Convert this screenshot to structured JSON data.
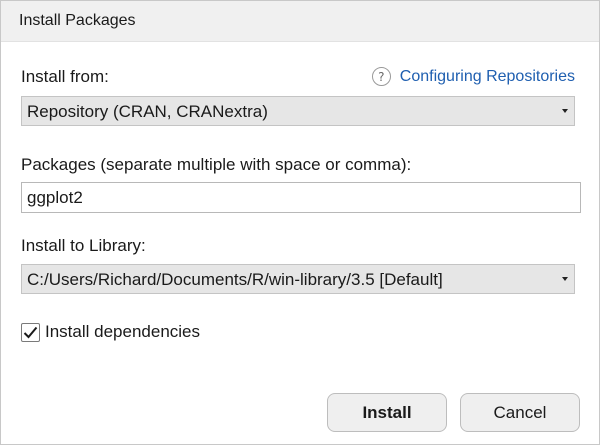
{
  "window": {
    "title": "Install Packages"
  },
  "install_from": {
    "label": "Install from:",
    "selected": "Repository (CRAN, CRANextra)"
  },
  "help": {
    "icon": "question-circle-icon",
    "icon_glyph": "?",
    "link_text": "Configuring Repositories"
  },
  "packages": {
    "label": "Packages (separate multiple with space or comma):",
    "value": "ggplot2"
  },
  "library": {
    "label": "Install to Library:",
    "selected": "C:/Users/Richard/Documents/R/win-library/3.5 [Default]"
  },
  "dependencies": {
    "label": "Install dependencies",
    "checked": true
  },
  "buttons": {
    "install": "Install",
    "cancel": "Cancel"
  },
  "colors": {
    "link": "#1f5fb0",
    "select_bg": "#e6e6e6",
    "button_bg": "#efefef"
  }
}
